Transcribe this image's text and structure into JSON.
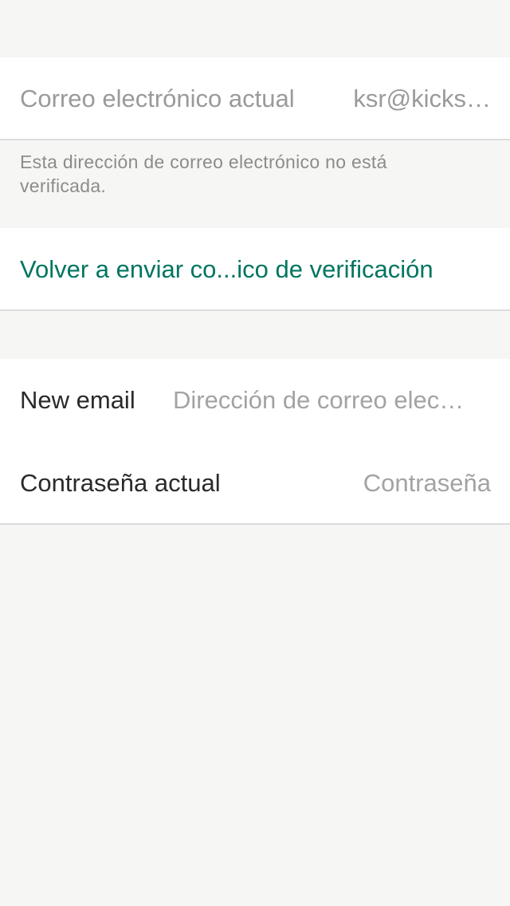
{
  "current_email": {
    "label": "Correo electrónico actual",
    "value": "ksr@kicks…"
  },
  "notice": {
    "text": "Esta dirección de correo electrónico no está verificada."
  },
  "resend": {
    "label": "Volver a enviar co...ico de verificación"
  },
  "form": {
    "new_email": {
      "label": "New email",
      "placeholder": "Dirección de correo elec…"
    },
    "password": {
      "label": "Contraseña actual",
      "placeholder": "Contraseña"
    }
  },
  "colors": {
    "background": "#f6f6f4",
    "accent": "#007560",
    "muted_text": "#9a9a9a"
  }
}
